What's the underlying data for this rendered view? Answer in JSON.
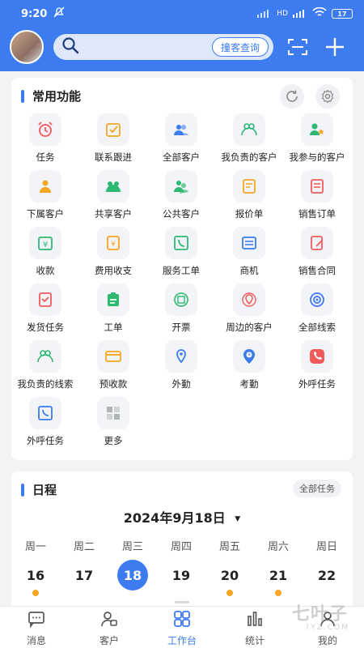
{
  "status": {
    "time": "9:20",
    "battery": "17",
    "network": "HD"
  },
  "header": {
    "search_button": "撞客查询"
  },
  "functions": {
    "title": "常用功能",
    "items": [
      {
        "label": "任务",
        "icon": "alarm-clock-icon",
        "color": "#f05a5a"
      },
      {
        "label": "联系跟进",
        "icon": "checkbox-icon",
        "color": "#f5a623"
      },
      {
        "label": "全部客户",
        "icon": "customers-icon",
        "color": "#3d7bf0"
      },
      {
        "label": "我负责的客户",
        "icon": "responsible-customers-icon",
        "color": "#2eb872"
      },
      {
        "label": "我参与的客户",
        "icon": "participant-customer-icon",
        "color": "#2eb872"
      },
      {
        "label": "下属客户",
        "icon": "subordinate-customer-icon",
        "color": "#f5a623"
      },
      {
        "label": "共享客户",
        "icon": "shared-customer-icon",
        "color": "#2eb872"
      },
      {
        "label": "公共客户",
        "icon": "public-customer-icon",
        "color": "#2eb872"
      },
      {
        "label": "报价单",
        "icon": "quote-icon",
        "color": "#f5a623"
      },
      {
        "label": "销售订单",
        "icon": "sales-order-icon",
        "color": "#f05a5a"
      },
      {
        "label": "收款",
        "icon": "payment-received-icon",
        "color": "#2eb872"
      },
      {
        "label": "费用收支",
        "icon": "expense-icon",
        "color": "#f5a623"
      },
      {
        "label": "服务工单",
        "icon": "service-ticket-icon",
        "color": "#2eb872"
      },
      {
        "label": "商机",
        "icon": "opportunity-icon",
        "color": "#3d7bf0"
      },
      {
        "label": "销售合同",
        "icon": "sales-contract-icon",
        "color": "#f05a5a"
      },
      {
        "label": "发货任务",
        "icon": "delivery-task-icon",
        "color": "#f05a5a"
      },
      {
        "label": "工单",
        "icon": "work-order-icon",
        "color": "#2eb872"
      },
      {
        "label": "开票",
        "icon": "invoice-icon",
        "color": "#2eb872"
      },
      {
        "label": "周边的客户",
        "icon": "nearby-customer-icon",
        "color": "#f05a5a"
      },
      {
        "label": "全部线索",
        "icon": "leads-target-icon",
        "color": "#3d7bf0"
      },
      {
        "label": "我负责的线索",
        "icon": "responsible-leads-icon",
        "color": "#2eb872"
      },
      {
        "label": "预收款",
        "icon": "prepayment-card-icon",
        "color": "#f5a623"
      },
      {
        "label": "外勤",
        "icon": "location-pin-icon",
        "color": "#3d7bf0"
      },
      {
        "label": "考勤",
        "icon": "attendance-clock-icon",
        "color": "#3d7bf0"
      },
      {
        "label": "外呼任务",
        "icon": "phone-icon",
        "color": "#f05a5a"
      },
      {
        "label": "外呼任务",
        "icon": "phone-screen-icon",
        "color": "#3d7bf0"
      },
      {
        "label": "更多",
        "icon": "more-grid-icon",
        "color": "#888888"
      }
    ]
  },
  "schedule": {
    "title": "日程",
    "all_tasks": "全部任务",
    "date": "2024年9月18日",
    "weekdays": [
      "周一",
      "周二",
      "周三",
      "周四",
      "周五",
      "周六",
      "周日"
    ],
    "days": [
      "16",
      "17",
      "18",
      "19",
      "20",
      "21",
      "22"
    ],
    "selected_index": 2,
    "dot_indices": [
      0,
      4,
      5
    ]
  },
  "bottom_nav": [
    {
      "label": "消息",
      "icon": "message-icon"
    },
    {
      "label": "客户",
      "icon": "customer-icon"
    },
    {
      "label": "工作台",
      "icon": "workbench-icon",
      "active": true
    },
    {
      "label": "统计",
      "icon": "statistics-icon"
    },
    {
      "label": "我的",
      "icon": "profile-icon"
    }
  ],
  "watermark": {
    "text": "七叶子",
    "sub": "7YZ.COM"
  }
}
